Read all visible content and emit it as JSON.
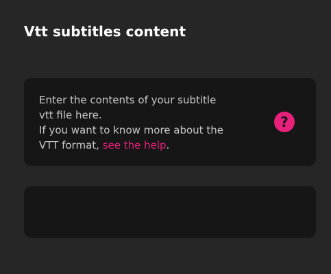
{
  "header": {
    "title": "Vtt subtitles content"
  },
  "info": {
    "line1": "Enter the contents of your subtitle",
    "line2": "vtt file here.",
    "line3": "If you want to know more about the",
    "line4_prefix": "VTT format, ",
    "help_link": "see the help",
    "line4_suffix": ".",
    "help_icon_glyph": "?",
    "help_icon": "question-mark-icon"
  },
  "editor": {
    "value": "",
    "placeholder": ""
  },
  "colors": {
    "background": "#262626",
    "card": "#161616",
    "accent": "#e8207b",
    "body_text": "#c7c7c7"
  }
}
